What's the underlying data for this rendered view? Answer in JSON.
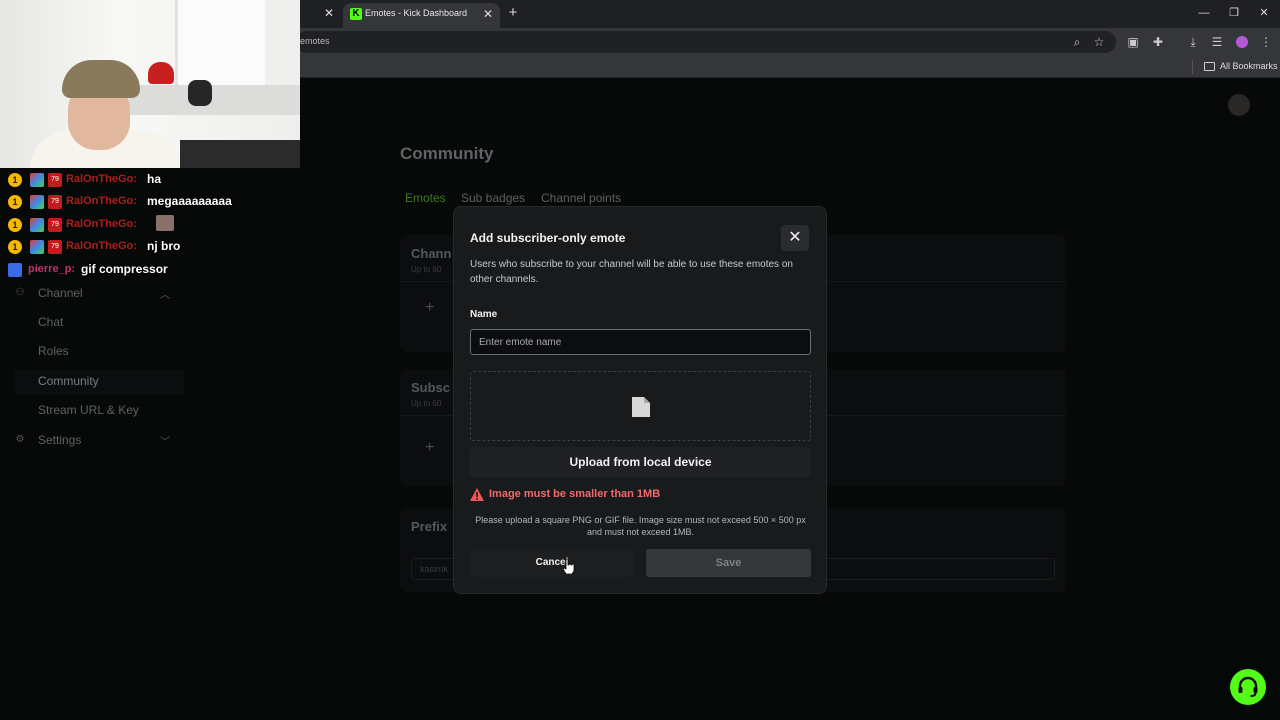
{
  "browser": {
    "active_tab_title": "Emotes - Kick Dashboard",
    "url_fragment": "emotes",
    "bookmarks_label": "All Bookmarks"
  },
  "sidebar": {
    "items": [
      {
        "label": "Channel",
        "icon": "people-icon",
        "expanded": true
      },
      {
        "label": "Chat"
      },
      {
        "label": "Roles"
      },
      {
        "label": "Community",
        "active": true
      },
      {
        "label": "Stream URL & Key"
      },
      {
        "label": "Settings",
        "icon": "gear-icon",
        "expanded": false
      }
    ]
  },
  "main": {
    "title": "Community",
    "tabs": [
      {
        "label": "Emotes",
        "active": true
      },
      {
        "label": "Sub badges"
      },
      {
        "label": "Channel points"
      }
    ],
    "cards": [
      {
        "title": "Chann",
        "subtitle": "Up to 60"
      },
      {
        "title": "Subsc",
        "subtitle": "Up to 60"
      },
      {
        "title": "Prefix",
        "input_value": "kasimk"
      }
    ]
  },
  "modal": {
    "title": "Add subscriber-only emote",
    "description": "Users who subscribe to your channel will be able to use these emotes on other channels.",
    "name_label": "Name",
    "name_placeholder": "Enter emote name",
    "upload_label": "Upload from local device",
    "error": "Image must be smaller than 1MB",
    "hint": "Please upload a square PNG or GIF file. Image size must not exceed 500 × 500 px and must not exceed 1MB.",
    "cancel_label": "Cancel",
    "save_label": "Save"
  },
  "chat_overlay": [
    {
      "user": "RalOnTheGo:",
      "message": "ha"
    },
    {
      "user": "RalOnTheGo:",
      "message": "megaaaaaaaaa"
    },
    {
      "user": "RalOnTheGo:",
      "message": ""
    },
    {
      "user": "RalOnTheGo:",
      "message": "nj bro"
    },
    {
      "user": "pierre_p:",
      "message": "gif compressor"
    }
  ],
  "colors": {
    "accent": "#53fc18",
    "error": "#f26a6a",
    "modal_bg": "#181a1c",
    "page_bg": "#070808"
  }
}
